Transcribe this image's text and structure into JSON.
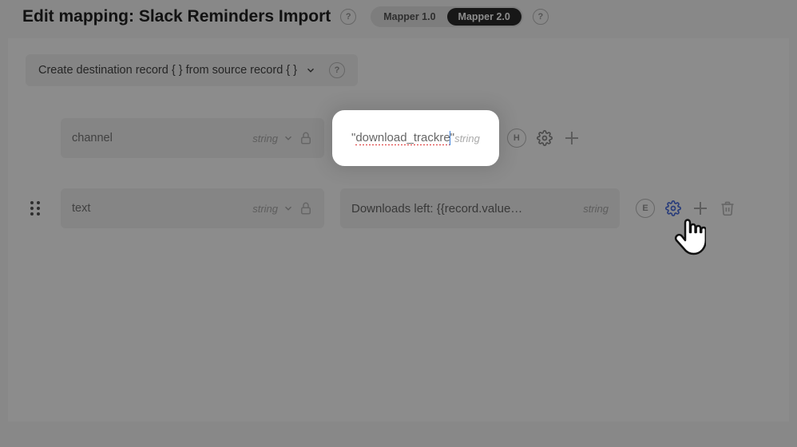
{
  "header": {
    "title": "Edit mapping: Slack Reminders Import",
    "mapper_v1": "Mapper 1.0",
    "mapper_v2": "Mapper 2.0"
  },
  "dest_bar": {
    "label": "Create destination record { } from source record { }"
  },
  "rows": [
    {
      "field_name": "channel",
      "field_type": "string",
      "value_display": "\"download_trackre\"",
      "value_prefix": "\"",
      "value_underlined": "download_trackre",
      "value_suffix": "\"",
      "value_type": "string",
      "badge": "H",
      "spotlight": true
    },
    {
      "field_name": "text",
      "field_type": "string",
      "value_display": "Downloads left: {{record.value…",
      "value_type": "string",
      "badge": "E",
      "spotlight": false
    }
  ],
  "icons": {
    "help": "?",
    "gear": "gear-icon",
    "plus": "plus-icon",
    "trash": "trash-icon",
    "lock": "lock-icon",
    "chevron_down": "chevron-down-icon",
    "drag": "drag-handle-icon"
  }
}
